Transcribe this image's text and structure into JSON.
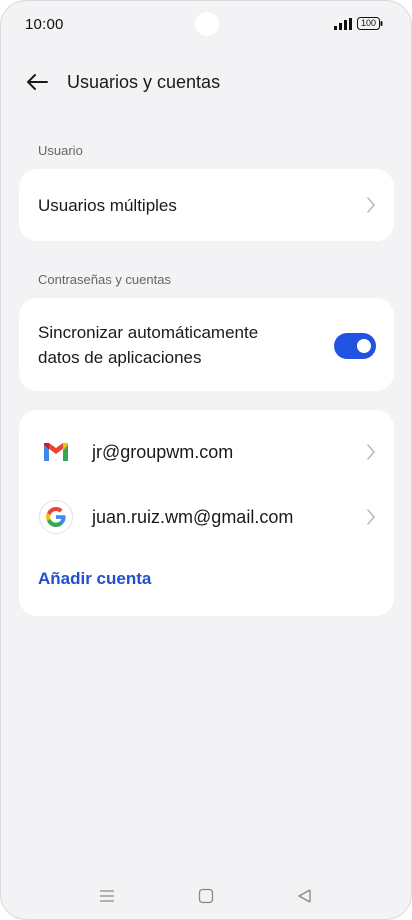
{
  "status_bar": {
    "time": "10:00",
    "battery": "100",
    "icons": [
      "signal-icon",
      "battery-icon"
    ]
  },
  "header": {
    "title": "Usuarios y cuentas",
    "back_icon": "arrow-left-icon"
  },
  "sections": {
    "user": {
      "label": "Usuario",
      "items": [
        {
          "label": "Usuarios múltiples",
          "icon": "chevron-right-icon"
        }
      ]
    },
    "passwords": {
      "label": "Contraseñas y cuentas",
      "sync": {
        "label_line1": "Sincronizar automáticamente",
        "label_line2": "datos de aplicaciones",
        "enabled": true
      }
    },
    "accounts": {
      "items": [
        {
          "label": "jr@groupwm.com",
          "icon": "gmail-icon"
        },
        {
          "label": "juan.ruiz.wm@gmail.com",
          "icon": "google-icon"
        }
      ],
      "add_label": "Añadir cuenta"
    }
  },
  "nav_bar": {
    "icons": [
      "menu-icon",
      "home-icon",
      "back-triangle-icon"
    ]
  },
  "colors": {
    "accent": "#2152e1",
    "link": "#2350c8",
    "background": "#f3f3f5",
    "card": "#ffffff"
  }
}
